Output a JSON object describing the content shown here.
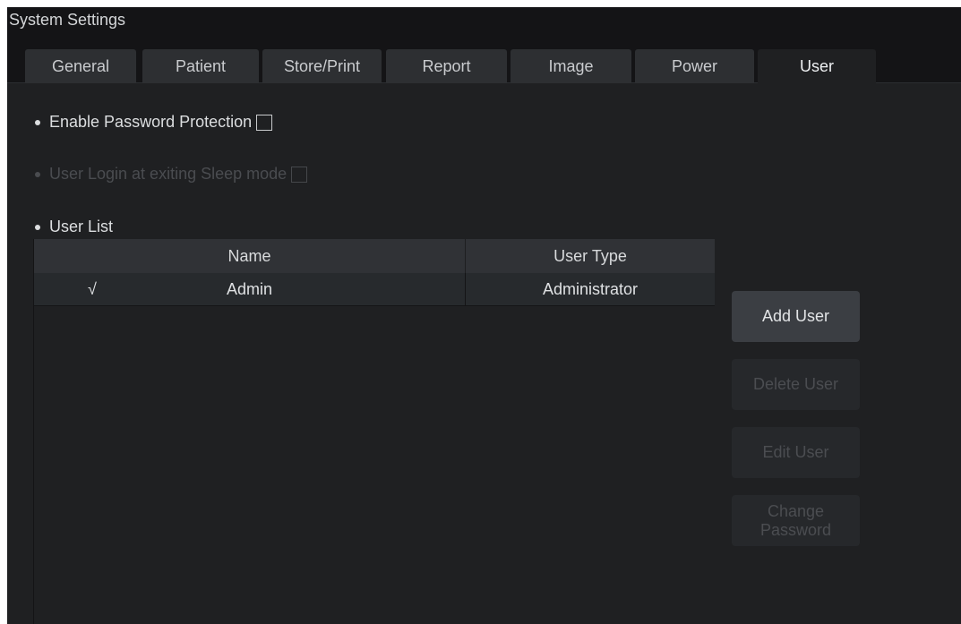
{
  "window": {
    "title": "System Settings"
  },
  "tabs": [
    {
      "label": "General",
      "active": false
    },
    {
      "label": "Patient",
      "active": false
    },
    {
      "label": "Store/Print",
      "active": false
    },
    {
      "label": "Report",
      "active": false
    },
    {
      "label": "Image",
      "active": false
    },
    {
      "label": "Power",
      "active": false
    },
    {
      "label": "User",
      "active": true
    }
  ],
  "options": {
    "password_protection": {
      "label": "Enable Password Protection",
      "checked": false,
      "enabled": true
    },
    "sleep_login": {
      "label": "User Login at exiting Sleep mode",
      "checked": false,
      "enabled": false
    }
  },
  "user_list": {
    "label": "User List",
    "columns": [
      "Name",
      "User Type"
    ],
    "rows": [
      {
        "selected_mark": "√",
        "name": "Admin",
        "type": "Administrator"
      }
    ]
  },
  "buttons": {
    "add_user": {
      "label": "Add User",
      "enabled": true
    },
    "delete_user": {
      "label": "Delete User",
      "enabled": false
    },
    "edit_user": {
      "label": "Edit User",
      "enabled": false
    },
    "change_password": {
      "label": "Change Password",
      "enabled": false
    }
  },
  "colors": {
    "background": "#1f2022",
    "header_background": "#141416",
    "tab_inactive": "#2d2f32",
    "text": "#dcdee0",
    "disabled_text": "#4a4c50"
  }
}
